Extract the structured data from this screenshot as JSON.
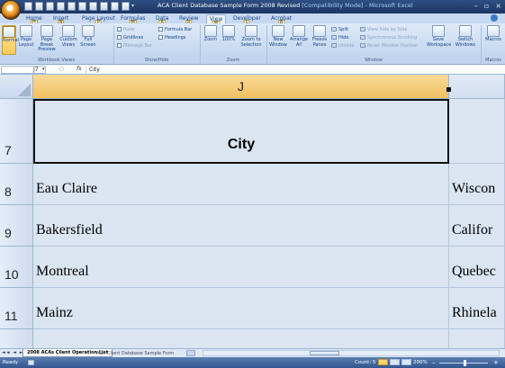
{
  "window": {
    "title": "ACA Client Database Sample Form 2008 Revised",
    "mode": " [Compatibility Mode] - Microsoft Excel",
    "controls": [
      "–",
      "▫",
      "×"
    ]
  },
  "tabs": [
    {
      "label": "Home",
      "key": "H"
    },
    {
      "label": "Insert",
      "key": "N"
    },
    {
      "label": "Page Layout",
      "key": "P"
    },
    {
      "label": "Formulas",
      "key": "M"
    },
    {
      "label": "Data",
      "key": "A"
    },
    {
      "label": "Review",
      "key": "R"
    },
    {
      "label": "View",
      "key": "W"
    },
    {
      "label": "Developer",
      "key": "L"
    },
    {
      "label": "Acrobat",
      "key": "B"
    }
  ],
  "active_tab": "View",
  "ribbon": {
    "workbook_views": {
      "buttons": [
        "Normal",
        "Page Layout",
        "Page Break Preview",
        "Custom Views",
        "Full Screen"
      ],
      "label": "Workbook Views"
    },
    "show_hide": {
      "checks": [
        "Ruler",
        "Gridlines",
        "Message Bar",
        "Formula Bar",
        "Headings"
      ],
      "label": "Show/Hide"
    },
    "zoom": {
      "buttons": [
        "Zoom",
        "100%",
        "Zoom to Selection"
      ],
      "label": "Zoom"
    },
    "window": {
      "buttons": [
        "New Window",
        "Arrange All",
        "Freeze Panes"
      ],
      "small": [
        "Split",
        "Hide",
        "Unhide",
        "View Side by Side",
        "Synchronous Scrolling",
        "Reset Window Position"
      ],
      "buttons2": [
        "Save Workspace",
        "Switch Windows"
      ],
      "label": "Window"
    },
    "macros": {
      "buttons": [
        "Macros"
      ],
      "label": "Macros"
    }
  },
  "formula_bar": {
    "name_box": "J7",
    "fx": "fx",
    "value": "City"
  },
  "sheet": {
    "columns": [
      "J",
      ""
    ],
    "header_row": {
      "row": "7",
      "value": "City"
    },
    "rows": [
      {
        "row": "8",
        "city": "Eau Claire",
        "next": "Wiscon"
      },
      {
        "row": "9",
        "city": "Bakersfield",
        "next": "Califor"
      },
      {
        "row": "10",
        "city": "Montreal",
        "next": "Quebec"
      },
      {
        "row": "11",
        "city": "Mainz",
        "next": "Rhinela"
      }
    ]
  },
  "sheet_tabs": {
    "nav": "◄◄ ◄ ► ►►",
    "active": "2008 ACAs Client Operation List",
    "other": "ACA Client Database Sample Form"
  },
  "status": {
    "ready": "Ready",
    "count": "Count: 5",
    "zoom": "200%",
    "minus": "–",
    "plus": "+",
    "zoom_level_percent": 200
  }
}
